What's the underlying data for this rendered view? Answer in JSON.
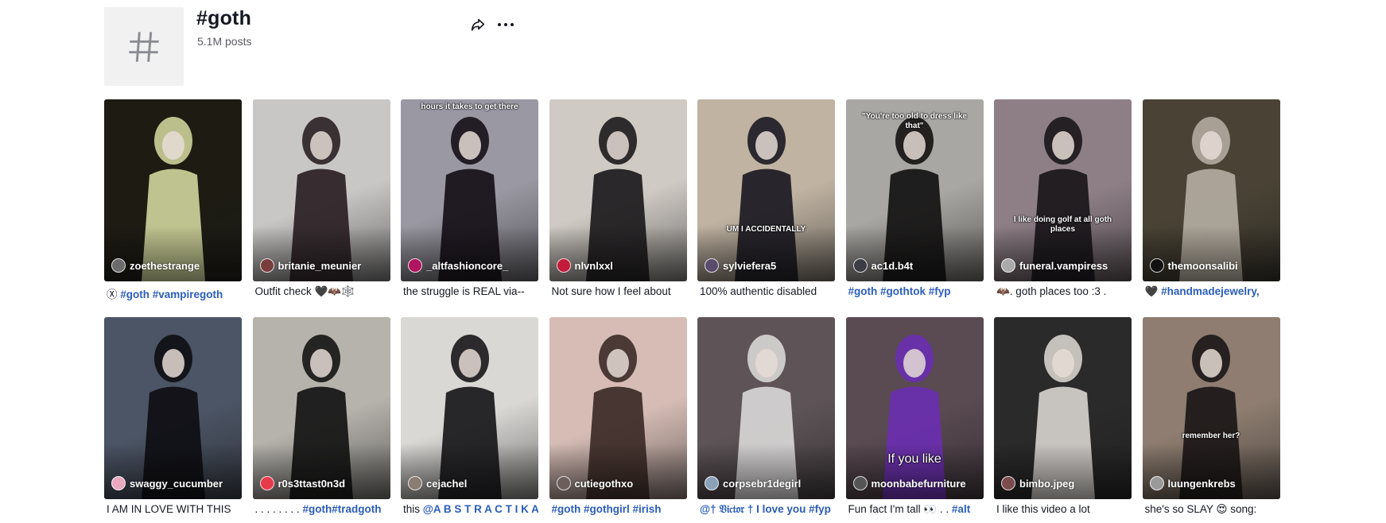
{
  "header": {
    "title": "#goth",
    "posts": "5.1M posts",
    "share_icon": "share-icon",
    "more_icon": "more-horizontal-icon"
  },
  "videos": [
    {
      "author": "zoethestrange",
      "caption_plain": "Ⓧ ",
      "caption_tags": "#goth #vampiregoth",
      "overlay": "",
      "bg": "#1d1b12",
      "accent": "#cdd19a",
      "avatar": "#6b6b6b"
    },
    {
      "author": "britanie_meunier",
      "caption_plain": "Outfit check 🖤🦇🕸️",
      "caption_tags": "",
      "overlay": "",
      "bg": "#c9c7c6",
      "accent": "#2a2024",
      "avatar": "#7a3d3d"
    },
    {
      "author": "_altfashioncore_",
      "caption_plain": "the struggle is REAL via--",
      "caption_tags": "",
      "overlay": "hours it takes to get there",
      "bg": "#9a98a2",
      "accent": "#161018",
      "avatar": "#b0155f"
    },
    {
      "author": "nlvnlxxl",
      "caption_plain": "Not sure how I feel about",
      "caption_tags": "",
      "overlay": "",
      "bg": "#cfcac4",
      "accent": "#1c1a1c",
      "avatar": "#c21c3a"
    },
    {
      "author": "sylviefera5",
      "caption_plain": "100% authentic disabled",
      "caption_tags": "",
      "overlay": "UM I ACCIDENTALLY",
      "bg": "#c0b3a2",
      "accent": "#1b1a22",
      "avatar": "#5a4b6c"
    },
    {
      "author": "ac1d.b4t",
      "caption_plain": "",
      "caption_tags": "#goth #gothtok #fyp",
      "overlay": "\"You're too old to dress like that\"",
      "bg": "#a9a7a3",
      "accent": "#141212",
      "avatar": "#3c3c44"
    },
    {
      "author": "funeral.vampiress",
      "caption_plain": "🦇. goth places too :3 .",
      "caption_tags": "",
      "overlay": "I like doing golf at all goth places",
      "bg": "#8e7f86",
      "accent": "#19161a",
      "avatar": "#aaaaaa"
    },
    {
      "author": "themoonsalibi",
      "caption_plain": "🖤 ",
      "caption_tags": "#handmadejewelry,",
      "overlay": "",
      "bg": "#4a4335",
      "accent": "#b3aba0",
      "avatar": "#111111"
    },
    {
      "author": "swaggy_cucumber",
      "caption_plain": "I AM IN LOVE WITH THIS",
      "caption_tags": "",
      "overlay": "",
      "bg": "#4c5566",
      "accent": "#0e0e12",
      "avatar": "#e9a8c0"
    },
    {
      "author": "r0s3ttast0n3d",
      "caption_plain": ". . . . . . . . ",
      "caption_tags": "#goth#tradgoth",
      "overlay": "",
      "bg": "#b6b3ad",
      "accent": "#141414",
      "avatar": "#e53a4a"
    },
    {
      "author": "cejachel",
      "caption_plain": "this ",
      "caption_tags": "@A B S T R A C T I K A",
      "overlay": "",
      "bg": "#d9d8d5",
      "accent": "#18171a",
      "avatar": "#8b7d72"
    },
    {
      "author": "cutiegothxo",
      "caption_plain": "",
      "caption_tags": "#goth #gothgirl #irish",
      "overlay": "",
      "bg": "#d6bcb5",
      "accent": "#3b2a26",
      "avatar": "#6c5f5b"
    },
    {
      "author": "corpsebr1degirl",
      "caption_plain": "",
      "caption_tags": "@† 𝔙𝔦𝔠𝔱𝔬𝔯 † I love you #fyp",
      "overlay": "",
      "bg": "#5e5458",
      "accent": "#d8d6d6",
      "avatar": "#8aa1b8"
    },
    {
      "author": "moonbabefurniture",
      "caption_plain": "Fun fact I'm tall 👀 . . ",
      "caption_tags": "#alt",
      "overlay": "If you like",
      "bg": "#5a4a52",
      "accent": "#6a2fb0",
      "avatar": "#555555"
    },
    {
      "author": "bimbo.jpeg",
      "caption_plain": "I like this video a lot",
      "caption_tags": "",
      "overlay": "",
      "bg": "#2b2a2a",
      "accent": "#d5d0cc",
      "avatar": "#7c4b4b"
    },
    {
      "author": "luungenkrebs",
      "caption_plain": "she's so SLAY 😍 song:",
      "caption_tags": "",
      "overlay": "remember her?",
      "bg": "#8e7d70",
      "accent": "#1b1717",
      "avatar": "#9a9a9a"
    }
  ]
}
